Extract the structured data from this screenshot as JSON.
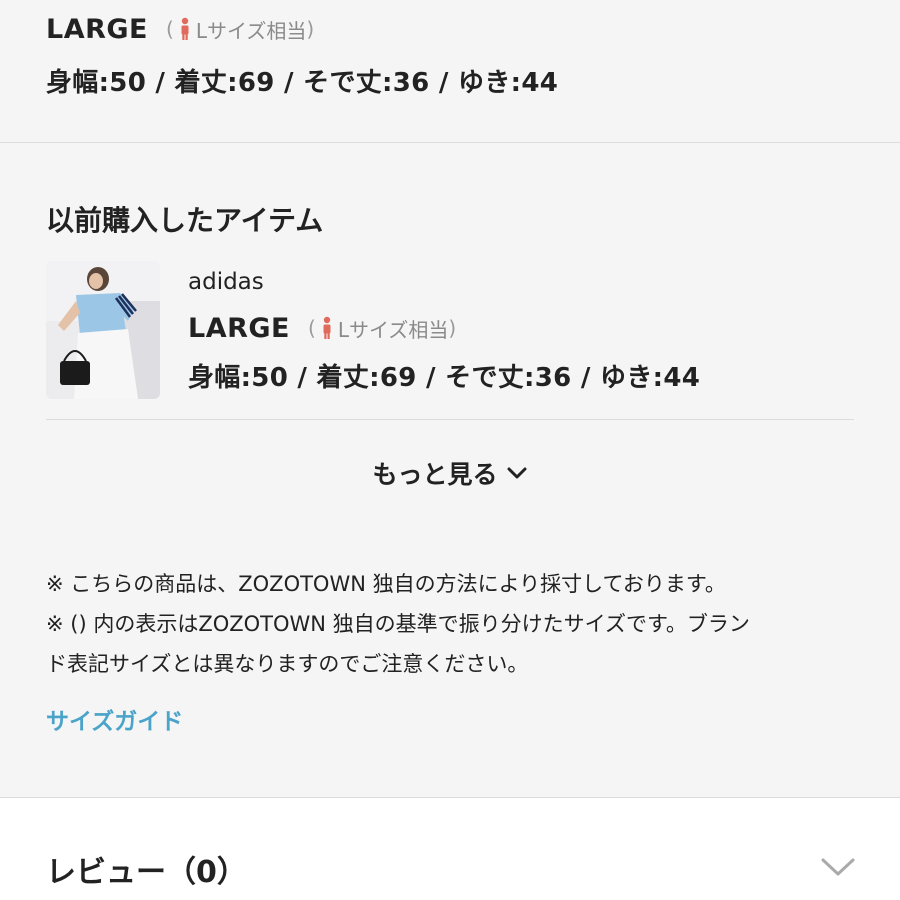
{
  "top_size": {
    "name": "LARGE",
    "equivalent_open": "(",
    "equivalent_label": "Lサイズ相当",
    "equivalent_close": ")",
    "measurements": "身幅:50 / 着丈:69 / そで丈:36 / ゆき:44"
  },
  "past_purchases": {
    "title": "以前購入したアイテム",
    "item": {
      "brand": "adidas",
      "size_name": "LARGE",
      "equivalent_open": "(",
      "equivalent_label": "Lサイズ相当",
      "equivalent_close": ")",
      "measurements": "身幅:50 / 着丈:69 / そで丈:36 / ゆき:44"
    },
    "more_label": "もっと見る"
  },
  "notes": {
    "line1": "※ こちらの商品は、ZOZOTOWN 独自の方法により採寸しております。",
    "line2": "※ () 内の表示はZOZOTOWN 独自の基準で振り分けたサイズです。ブラン",
    "line3": "ド表記サイズとは異なりますのでご注意ください。"
  },
  "size_guide_label": "サイズガイド",
  "review": {
    "label": "レビュー（0）"
  },
  "colors": {
    "link": "#4aa3c8",
    "person_icon": "#e06a5c"
  },
  "icons": {
    "size_person": "person-icon",
    "more": "chevron-down-icon",
    "review": "chevron-down-icon"
  }
}
